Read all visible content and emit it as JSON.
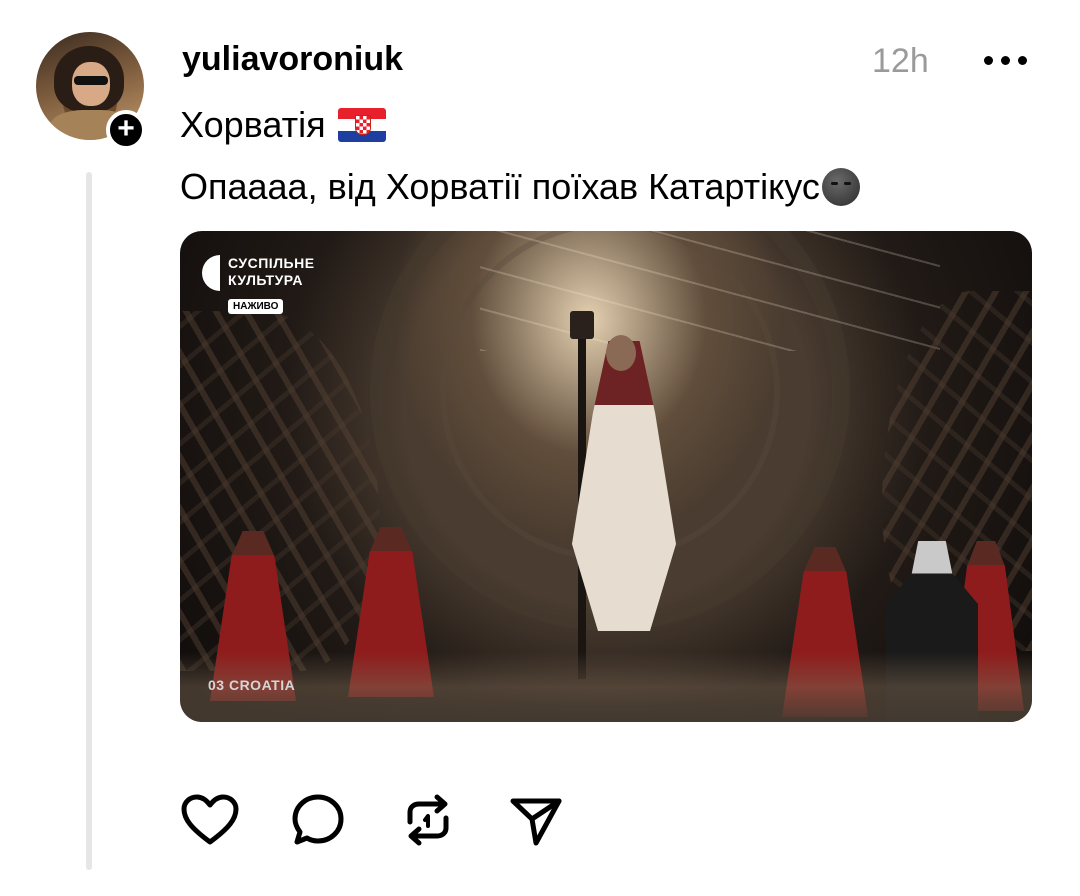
{
  "post": {
    "username": "yuliavoroniuk",
    "timestamp": "12h",
    "topic": "Хорватія",
    "text": "Опаааа, від Хорватії поїхав Катартікус"
  },
  "media": {
    "broadcaster": "СУСПІЛЬНЕ КУЛЬТУРА",
    "live_badge": "НАЖИВО",
    "country_label": "03 CROATIA"
  },
  "icons": {
    "follow": "plus-icon",
    "more": "more-horizontal-icon",
    "flag": "croatia-flag-icon",
    "emoji": "new-moon-face-icon",
    "like": "heart-icon",
    "reply": "comment-icon",
    "repost": "repost-icon",
    "share": "send-icon"
  },
  "colors": {
    "text": "#000000",
    "muted": "#9a9a9a",
    "thread_line": "#e6e6e6"
  }
}
